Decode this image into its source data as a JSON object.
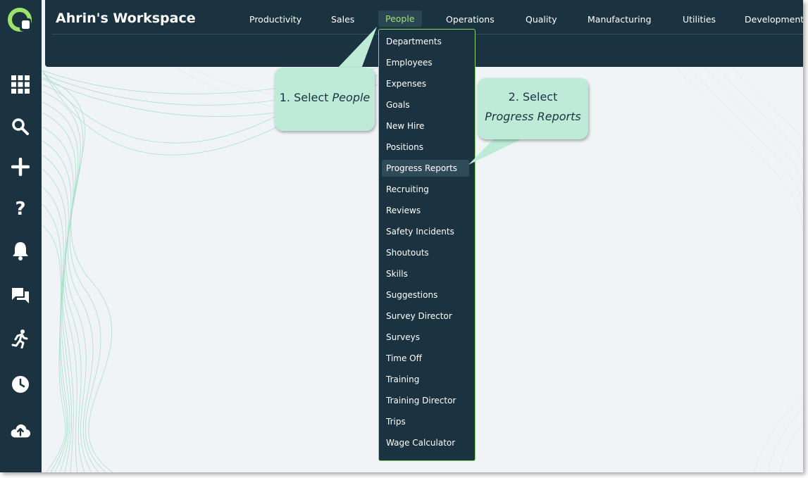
{
  "workspace": {
    "title": "Ahrin's Workspace"
  },
  "nav": {
    "items": [
      {
        "label": "Productivity"
      },
      {
        "label": "Sales"
      },
      {
        "label": "People"
      },
      {
        "label": "Operations"
      },
      {
        "label": "Quality"
      },
      {
        "label": "Manufacturing"
      },
      {
        "label": "Utilities"
      },
      {
        "label": "Development"
      }
    ],
    "active": "People"
  },
  "sidebar": {
    "icons": [
      "apps-grid-icon",
      "search-icon",
      "plus-icon",
      "help-icon",
      "bell-icon",
      "chat-icon",
      "runner-icon",
      "clock-icon",
      "cloud-upload-icon"
    ]
  },
  "people_menu": {
    "items": [
      {
        "label": "Departments"
      },
      {
        "label": "Employees"
      },
      {
        "label": "Expenses"
      },
      {
        "label": "Goals"
      },
      {
        "label": "New Hire"
      },
      {
        "label": "Positions"
      },
      {
        "label": "Progress Reports"
      },
      {
        "label": "Recruiting"
      },
      {
        "label": "Reviews"
      },
      {
        "label": "Safety Incidents"
      },
      {
        "label": "Shoutouts"
      },
      {
        "label": "Skills"
      },
      {
        "label": "Suggestions"
      },
      {
        "label": "Survey Director"
      },
      {
        "label": "Surveys"
      },
      {
        "label": "Time Off"
      },
      {
        "label": "Training"
      },
      {
        "label": "Training Director"
      },
      {
        "label": "Trips"
      },
      {
        "label": "Wage Calculator"
      }
    ],
    "highlighted": "Progress Reports"
  },
  "callouts": {
    "step1": {
      "prefix": "1. Select ",
      "emphasis": "People"
    },
    "step2": {
      "prefix": "2. Select",
      "emphasis": "Progress Reports"
    }
  },
  "colors": {
    "navy": "#1b3340",
    "accent_green": "#9ee26a",
    "callout_bg": "#bdebd7",
    "background": "#f1f4f7"
  }
}
